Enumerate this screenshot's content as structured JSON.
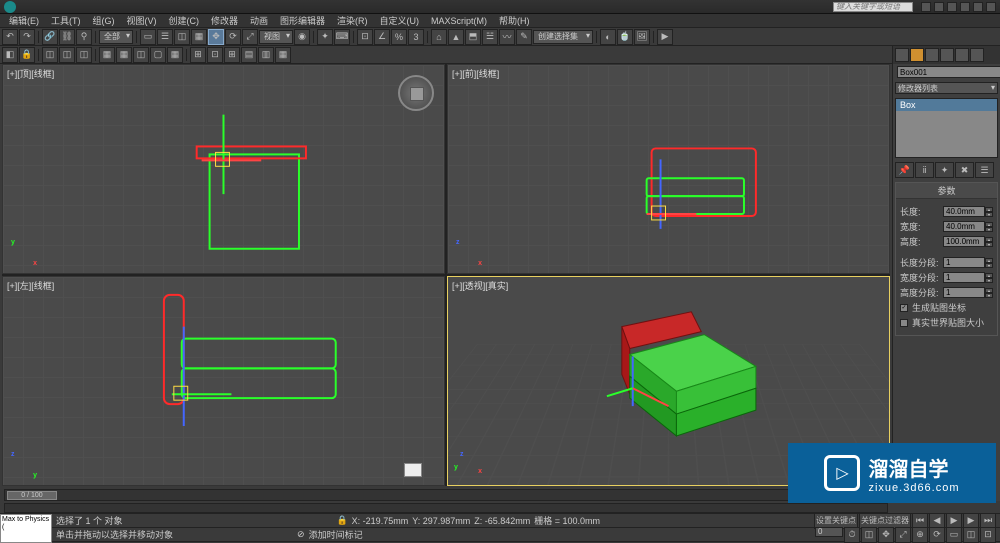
{
  "title_search_placeholder": "键入关键字或短语",
  "menu": {
    "items": [
      "编辑(E)",
      "工具(T)",
      "组(G)",
      "视图(V)",
      "创建(C)",
      "修改器",
      "动画",
      "图形编辑器",
      "渲染(R)",
      "自定义(U)",
      "MAXScript(M)",
      "帮助(H)"
    ]
  },
  "toolbar1": {
    "scope": "全部",
    "selection_filter": "创建选择集"
  },
  "viewports": {
    "top": "[+][顶][线框]",
    "front": "[+][前][线框]",
    "left": "[+][左][线框]",
    "persp": "[+][透视][真实]"
  },
  "cmd_panel": {
    "object_name": "Box001",
    "modifier_dropdown": "修改器列表",
    "stack_item": "Box",
    "rollout_params": "参数",
    "params": {
      "length_label": "长度:",
      "length_value": "40.0mm",
      "width_label": "宽度:",
      "width_value": "40.0mm",
      "height_label": "高度:",
      "height_value": "100.0mm",
      "lsegs_label": "长度分段:",
      "lsegs_value": "1",
      "wsegs_label": "宽度分段:",
      "wsegs_value": "1",
      "hsegs_label": "高度分段:",
      "hsegs_value": "1",
      "gen_uv": "生成贴图坐标",
      "real_world": "真实世界贴图大小"
    }
  },
  "timeline": {
    "slider_text": "0 / 100"
  },
  "status": {
    "maxscript": "Max to Physics (",
    "selected": "选择了 1 个 对象",
    "hint": "单击并拖动以选择并移动对象",
    "x": "X: -219.75mm",
    "y": "Y: 297.987mm",
    "z": "Z: -65.842mm",
    "grid": "栅格 = 100.0mm",
    "add_time_tag": "添加时间标记",
    "set_key": "设置关键点",
    "key_filter": "关键点过滤器"
  },
  "watermark": {
    "title": "溜溜自学",
    "subtitle": "zixue.3d66.com"
  }
}
